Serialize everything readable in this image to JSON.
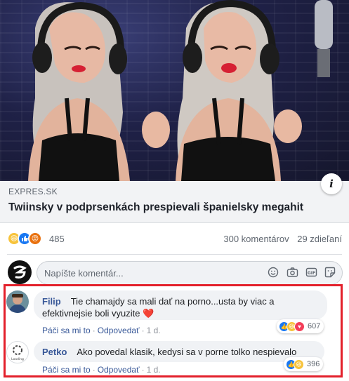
{
  "link_preview": {
    "source": "EXPRES.SK",
    "title": "Twiinsky v podprsenkách prespievali španielsky megahit",
    "info_icon": "info-icon"
  },
  "stats": {
    "reaction_icons": [
      "haha-reaction-icon",
      "like-reaction-icon",
      "angry-reaction-icon"
    ],
    "reaction_count": "485",
    "comments": "300 komentárov",
    "shares": "29 zdieľaní"
  },
  "composer": {
    "placeholder": "Napíšte komentár...",
    "icons": [
      "emoji-icon",
      "camera-icon",
      "gif-icon",
      "sticker-icon"
    ]
  },
  "comments": [
    {
      "author": "Filip",
      "text_line1": "Tie chamajdy sa mali dať na porno...usta by viac a",
      "text_line2": "efektivnejsie boli vyuzite ❤️",
      "like_label": "Páči sa mi to",
      "reply_label": "Odpovedať",
      "time": "1 d.",
      "reaction_count": "607",
      "reaction_icons": [
        "like-reaction-icon",
        "haha-reaction-icon",
        "love-reaction-icon"
      ]
    },
    {
      "author": "Petko",
      "text": "Ako povedal klasik, kedysi sa v porne tolko nespievalo",
      "like_label": "Páči sa mi to",
      "reply_label": "Odpovedať",
      "time": "1 d.",
      "reaction_count": "396",
      "reaction_icons": [
        "like-reaction-icon",
        "haha-reaction-icon"
      ],
      "avatar_caption": "Loading"
    }
  ],
  "colors": {
    "link_blue": "#385898",
    "highlight_red": "#e3202b",
    "bubble_gray": "#f0f2f5"
  }
}
